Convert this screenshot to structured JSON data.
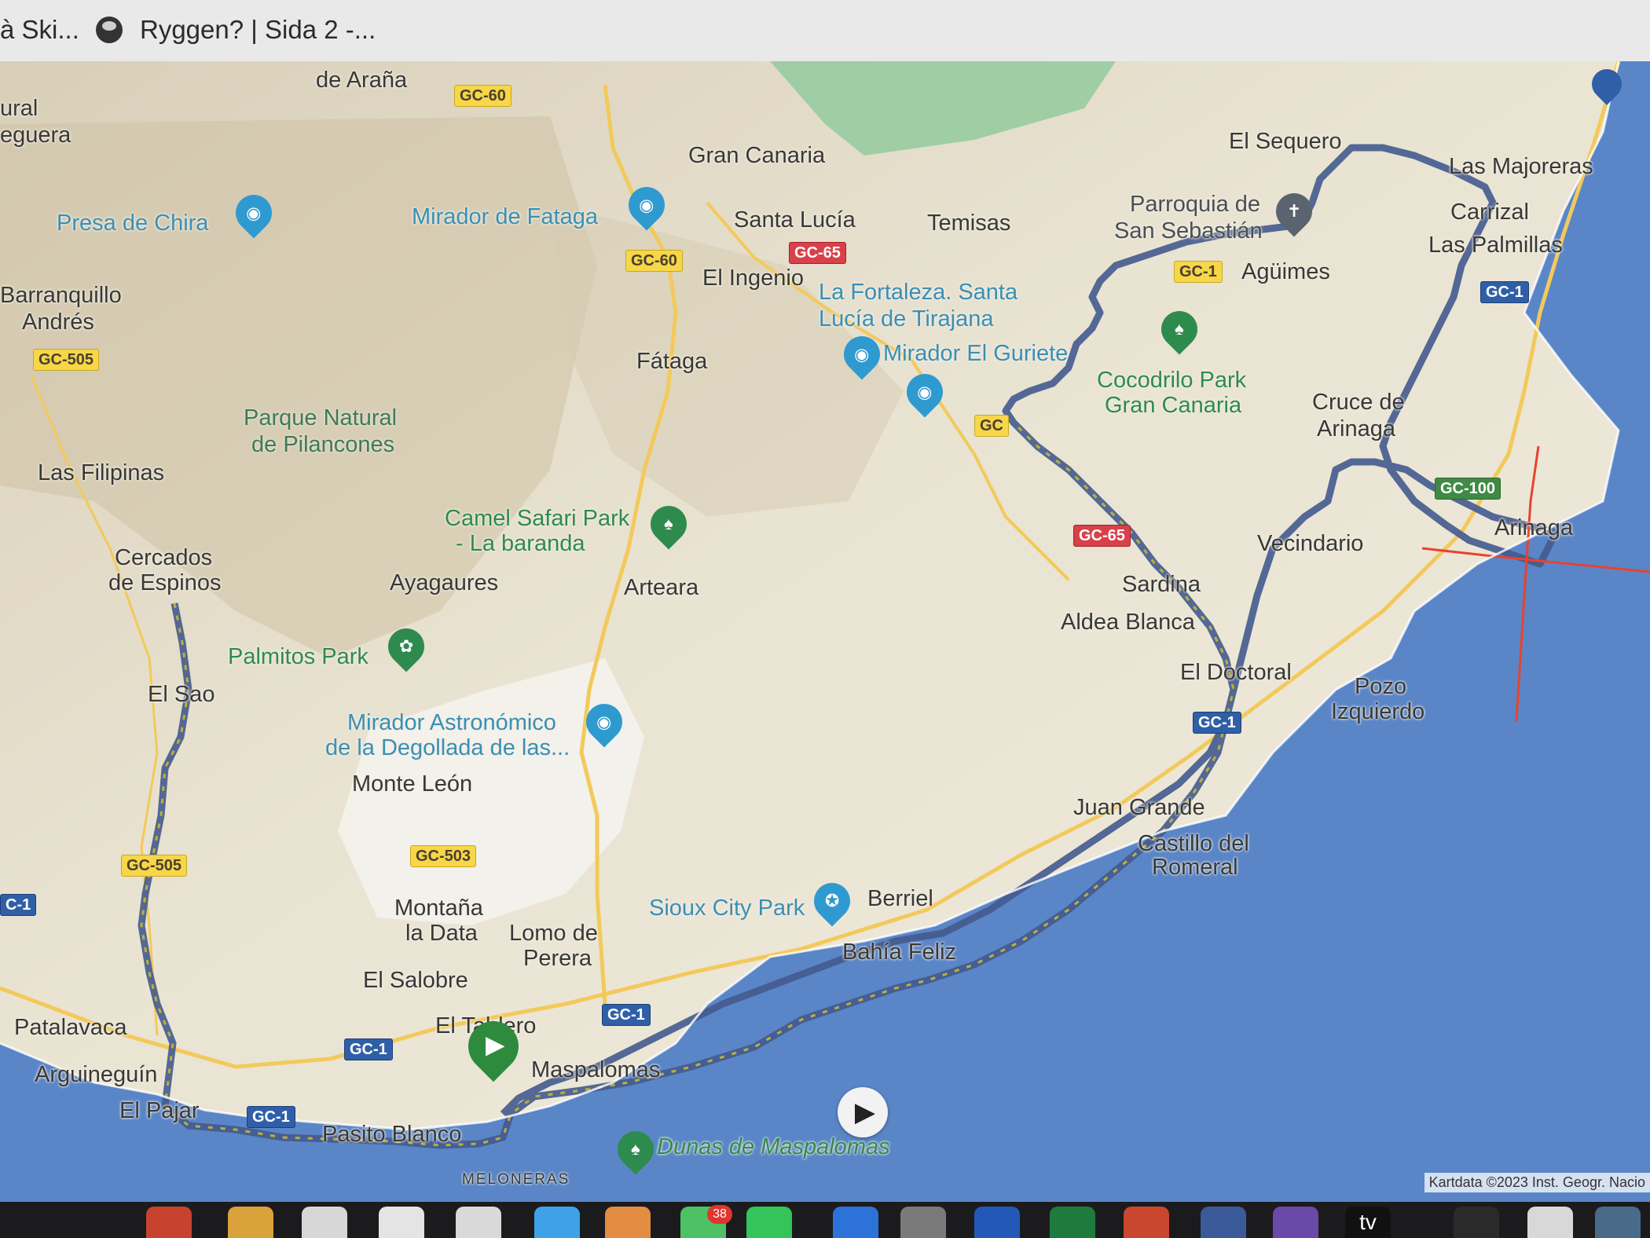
{
  "tabs": [
    {
      "label": "à Ski..."
    },
    {
      "label": "Ryggen? | Sida 2 -..."
    }
  ],
  "places": {
    "de_arana": "de Araña",
    "ural": "ural",
    "eguera": "eguera",
    "presa_de_chira": "Presa de Chira",
    "barranquillo": "Barranquillo",
    "andres": "Andrés",
    "gran_canaria": "Gran Canaria",
    "mirador_de_fataga": "Mirador de Fataga",
    "santa_lucia": "Santa Lucía",
    "temisas": "Temisas",
    "el_ingenio": "El Ingenio",
    "la_fortaleza_1": "La Fortaleza. Santa",
    "la_fortaleza_2": "Lucía de Tirajana",
    "mirador_el_guriete": "Mirador El Guriete",
    "el_sequero": "El Sequero",
    "parroquia_1": "Parroquia de",
    "parroquia_2": "San Sebastián",
    "las_majoreras": "Las Majoreras",
    "carrizal": "Carrizal",
    "las_palmillas": "Las Palmillas",
    "aguimes": "Agüimes",
    "fataga": "Fátaga",
    "cocodrilo_1": "Cocodrilo Park",
    "cocodrilo_2": "Gran Canaria",
    "cruce_1": "Cruce de",
    "cruce_2": "Arinaga",
    "arinaga": "Arinaga",
    "parque_1": "Parque Natural",
    "parque_2": "de Pilancones",
    "las_filipinas": "Las Filipinas",
    "camel_1": "Camel Safari Park",
    "camel_2": "- La baranda",
    "cercados_1": "Cercados",
    "cercados_2": "de Espinos",
    "ayagaures": "Ayagaures",
    "arteara": "Arteara",
    "vecindario": "Vecindario",
    "sardina": "Sardina",
    "aldea_blanca": "Aldea Blanca",
    "palmitos_park": "Palmitos Park",
    "el_doctoral": "El Doctoral",
    "pozo_1": "Pozo",
    "pozo_2": "Izquierdo",
    "el_sao": "El Sao",
    "mirador_astro_1": "Mirador Astronómico",
    "mirador_astro_2": "de la Degollada de las...",
    "monte_leon": "Monte León",
    "juan_grande": "Juan Grande",
    "castillo_1": "Castillo del",
    "castillo_2": "Romeral",
    "montana_1": "Montaña",
    "montana_2": "la Data",
    "lomo_1": "Lomo de",
    "lomo_2": "Perera",
    "sioux_city_park": "Sioux City Park",
    "berriel": "Berriel",
    "bahia_feliz": "Bahía Feliz",
    "el_salobre": "El Salobre",
    "patalavaca": "Patalavaca",
    "el_tablero": "El Tablero",
    "arguineguin": "Arguineguín",
    "maspalomas": "Maspalomas",
    "el_pajar": "El Pajar",
    "pasito_blanco": "Pasito Blanco",
    "meloneras": "MELONERAS",
    "dunas": "Dunas de Maspalomas"
  },
  "roads": {
    "gc60_a": "GC-60",
    "gc60_b": "GC-60",
    "gc65_a": "GC-65",
    "gc65_b": "GC-65",
    "gc505_a": "GC-505",
    "gc505_b": "GC-505",
    "gc503": "GC-503",
    "gc1_a": "GC-1",
    "gc1_b": "GC-1",
    "gc1_c": "GC-1",
    "gc1_d": "GC-1",
    "gc1_e": "GC-1",
    "gc1_f": "C-1",
    "gc100": "GC-100",
    "gc_partial_a": "GC",
    "gc_partial_b": "GC-1"
  },
  "attribution": "Kartdata ©2023 Inst. Geogr. Nacio",
  "dock": {
    "mail_badge": "38",
    "tv_label": "tv"
  },
  "colors": {
    "water": "#5a86c8",
    "land": "#f1ece0",
    "route": "#4a5d8c",
    "annotation": "#e8422e"
  }
}
